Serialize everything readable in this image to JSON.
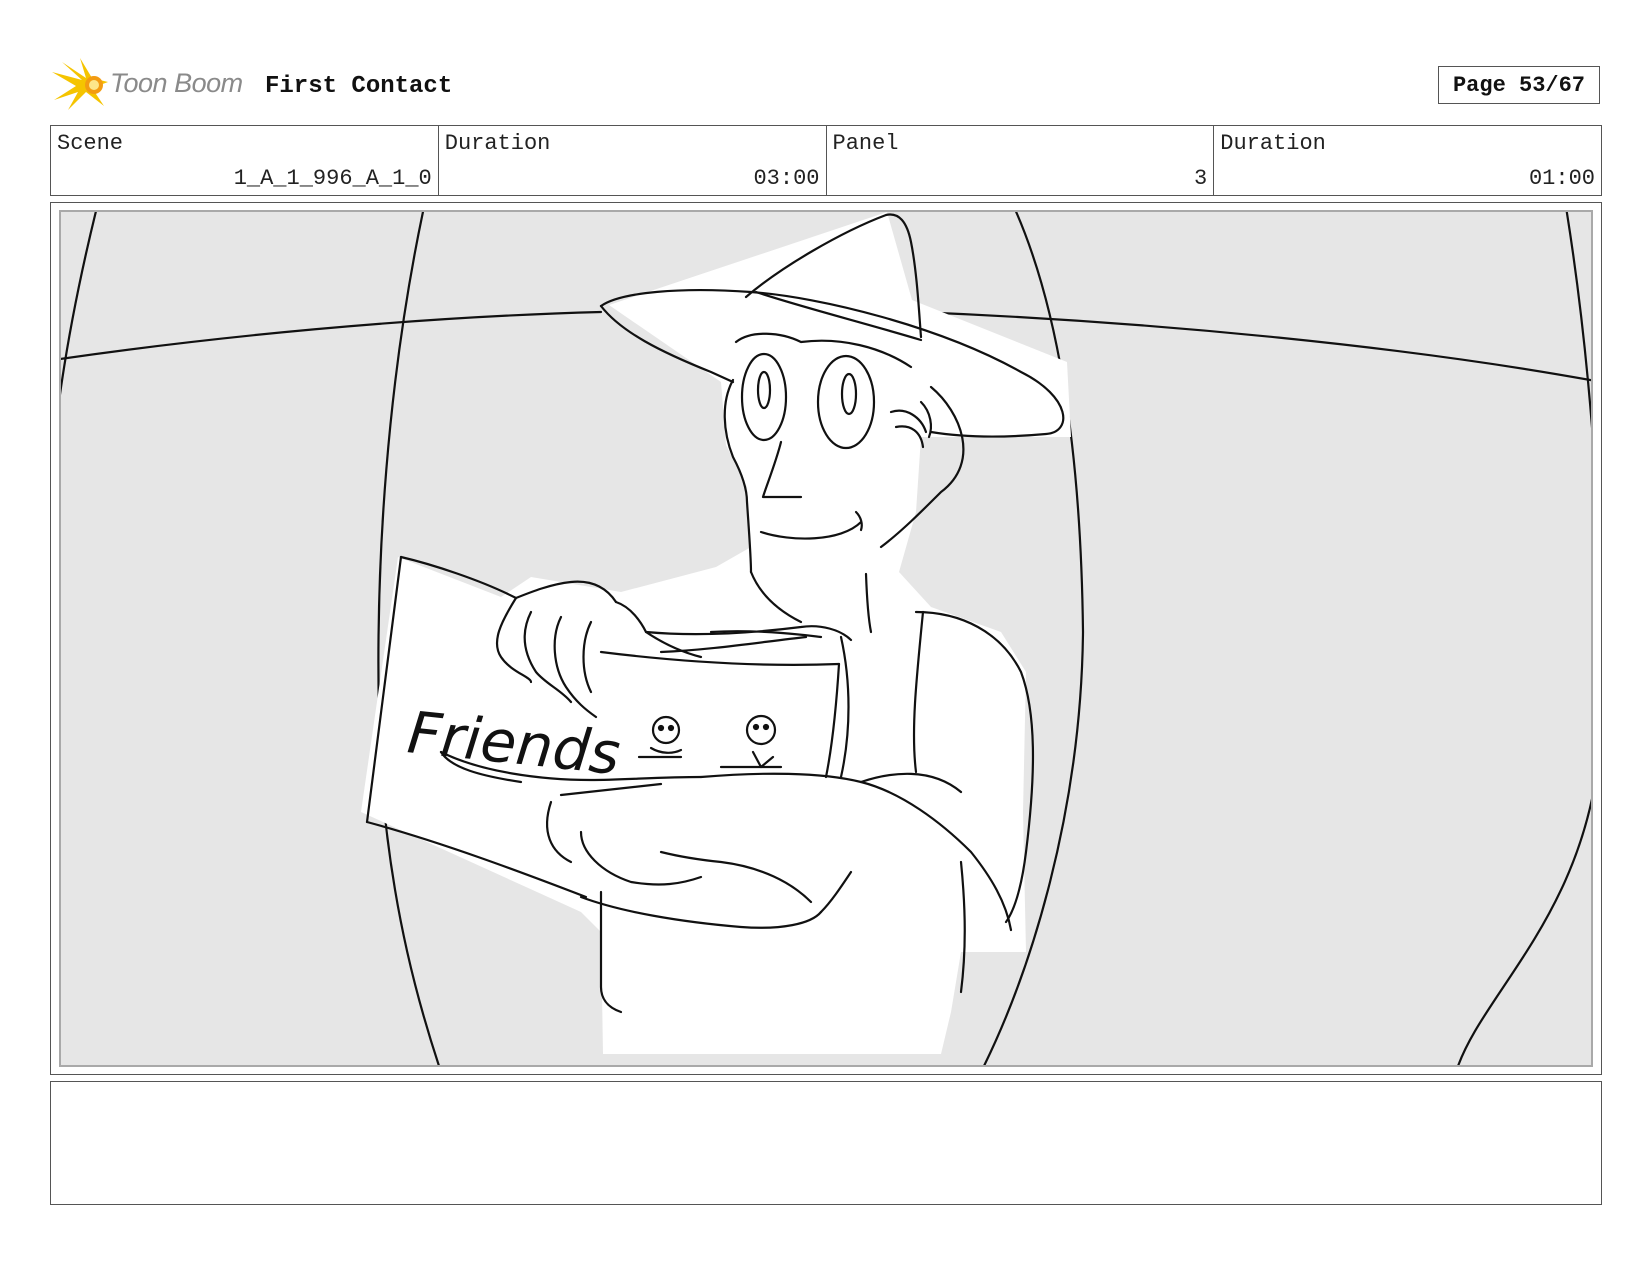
{
  "header": {
    "logo_text": "Toon Boom",
    "project_title": "First Contact",
    "page_label": "Page 53/67"
  },
  "info": {
    "scene_label": "Scene",
    "scene_value": "1_A_1_996_A_1_0",
    "scene_duration_label": "Duration",
    "scene_duration_value": "03:00",
    "panel_label": "Panel",
    "panel_value": "3",
    "panel_duration_label": "Duration",
    "panel_duration_value": "01:00"
  },
  "panel": {
    "sign_text": "Friends",
    "background_color": "#e6e6e6",
    "frame_color": "#a9a9a9"
  },
  "notes": {
    "text": ""
  },
  "colors": {
    "logo_yellow": "#f5c400",
    "logo_orange": "#f39c12",
    "logo_text_gray": "#8a8a8a",
    "border": "#555555"
  }
}
